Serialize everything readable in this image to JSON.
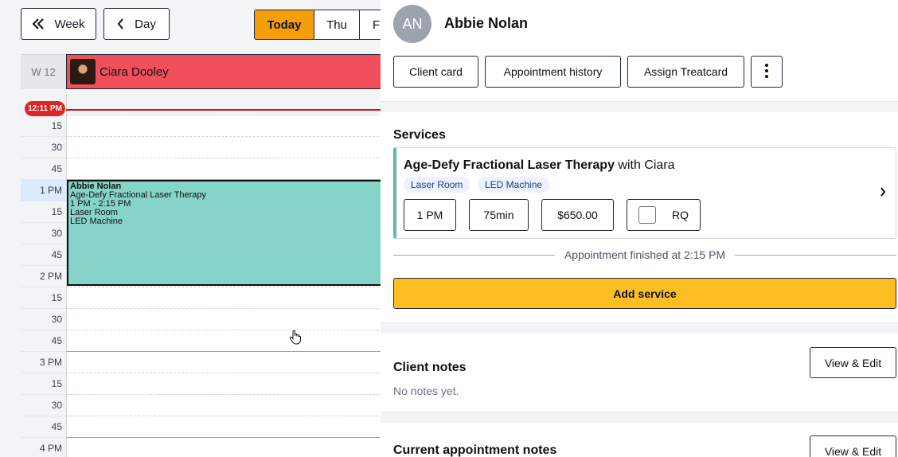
{
  "toolbar": {
    "week_label": "Week",
    "day_label": "Day",
    "today_label": "Today",
    "thu_label": "Thu",
    "fri_label": "F"
  },
  "calendar": {
    "week_label": "W 12",
    "staff_name": "Ciara Dooley",
    "now_badge": "12:11 PM",
    "rows": [
      {
        "label": "",
        "hour": false
      },
      {
        "label": "15",
        "hour": false
      },
      {
        "label": "30",
        "hour": false
      },
      {
        "label": "45",
        "hour": false
      },
      {
        "label": "1 PM",
        "hour": true,
        "highlight": true
      },
      {
        "label": "15",
        "hour": false
      },
      {
        "label": "30",
        "hour": false
      },
      {
        "label": "45",
        "hour": false
      },
      {
        "label": "2 PM",
        "hour": true
      },
      {
        "label": "15",
        "hour": false
      },
      {
        "label": "30",
        "hour": false
      },
      {
        "label": "45",
        "hour": false
      },
      {
        "label": "3 PM",
        "hour": true
      },
      {
        "label": "15",
        "hour": false
      },
      {
        "label": "30",
        "hour": false
      },
      {
        "label": "45",
        "hour": false
      },
      {
        "label": "4 PM",
        "hour": true
      }
    ],
    "appointment": {
      "client": "Abbie Nolan",
      "service": "Age-Defy Fractional Laser Therapy",
      "time": "1 PM - 2:15 PM",
      "room": "Laser Room",
      "machine": "LED Machine"
    }
  },
  "panel": {
    "initials": "AN",
    "client_name": "Abbie Nolan",
    "client_card_label": "Client card",
    "appointment_history_label": "Appointment history",
    "assign_treatcard_label": "Assign Treatcard",
    "services_heading": "Services",
    "service": {
      "name": "Age-Defy Fractional Laser Therapy",
      "with_text": "with Ciara",
      "tags": [
        "Laser Room",
        "LED Machine"
      ],
      "start_time": "1 PM",
      "duration": "75min",
      "price": "$650.00",
      "rq_label": "RQ"
    },
    "finished_text": "Appointment finished at 2:15 PM",
    "add_service_label": "Add service",
    "client_notes_heading": "Client notes",
    "client_notes_empty": "No notes yet.",
    "view_edit_label": "View & Edit",
    "current_notes_heading": "Current appointment notes",
    "view_edit_label_2": "View & Edit"
  },
  "colors": {
    "today_accent": "#f59e0b",
    "staff_header": "#f0505b",
    "appointment_fill": "#86d3c7",
    "add_service": "#fbbf24",
    "now_indicator": "#dc2626"
  }
}
